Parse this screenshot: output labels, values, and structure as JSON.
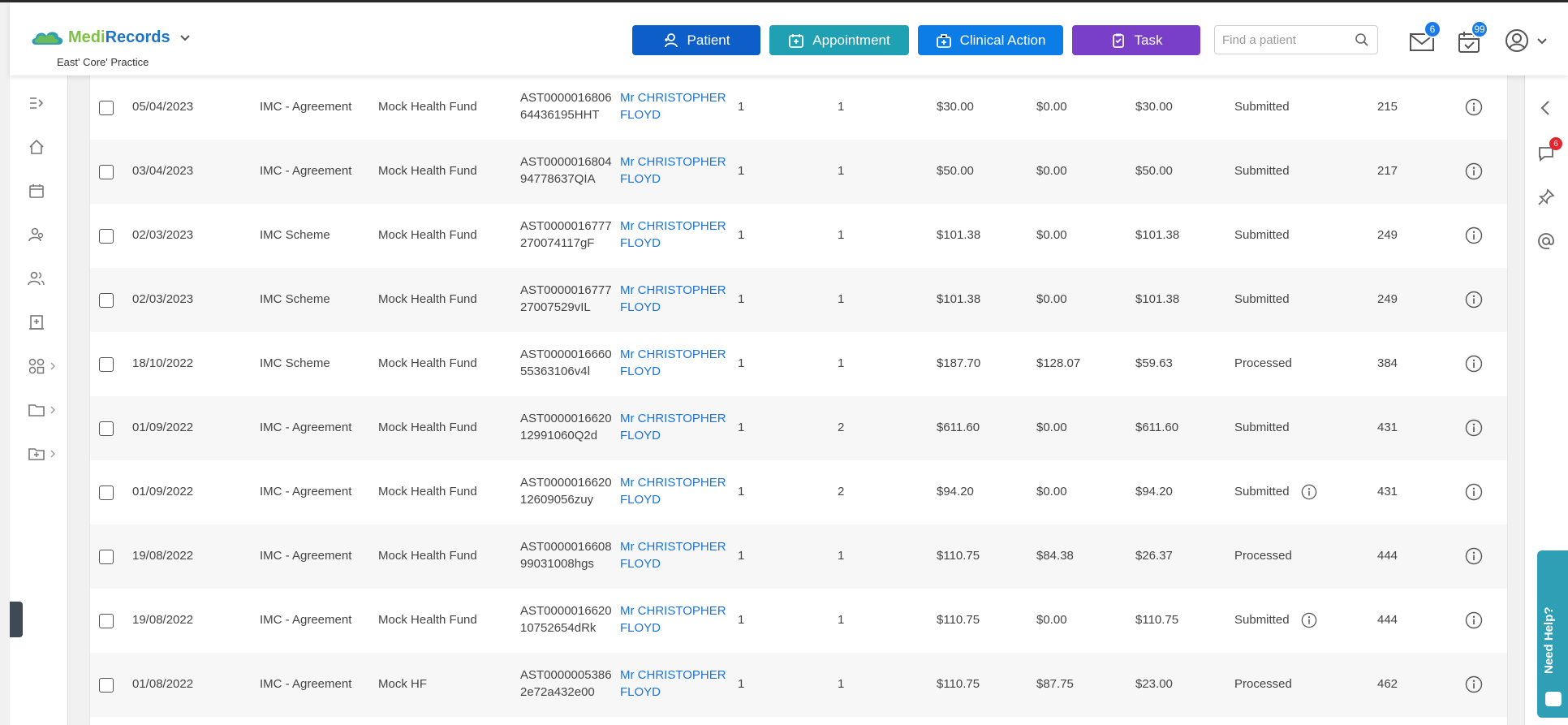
{
  "app": {
    "brand_part1": "Medi",
    "brand_part2": "Records",
    "practice": "East' Core' Practice"
  },
  "header": {
    "buttons": {
      "patient": "Patient",
      "appointment": "Appointment",
      "clinical_action": "Clinical Action",
      "task": "Task"
    },
    "search_placeholder": "Find a patient",
    "mail_badge": "6",
    "tasks_badge": "99"
  },
  "right_sidebar": {
    "chat_badge": "6",
    "help_label": "Need Help?"
  },
  "colors": {
    "patient": "#0d5ec9",
    "appointment": "#1fa0b3",
    "clinical_action": "#0c7ce6",
    "task": "#7a3fc9",
    "link": "#1a73d9",
    "help": "#2f9fb6"
  },
  "left_sidebar_icons": [
    "collapse-icon",
    "home-icon",
    "calendar-icon",
    "patients-icon",
    "contacts-icon",
    "clinic-icon",
    "modules-icon",
    "folder-icon",
    "folder-add-icon"
  ],
  "rows": [
    {
      "date": "05/04/2023",
      "type": "IMC - Agreement",
      "fund": "Mock Health Fund",
      "ref1": "AST0000016806",
      "ref2": "64436195HHT",
      "patient1": "Mr CHRISTOPHER",
      "patient2": "FLOYD",
      "n1": "1",
      "n2": "1",
      "amount": "$30.00",
      "paid": "$0.00",
      "balance": "$30.00",
      "status": "Submitted",
      "status_info": false,
      "days": "215"
    },
    {
      "date": "03/04/2023",
      "type": "IMC - Agreement",
      "fund": "Mock Health Fund",
      "ref1": "AST0000016804",
      "ref2": "94778637QIA",
      "patient1": "Mr CHRISTOPHER",
      "patient2": "FLOYD",
      "n1": "1",
      "n2": "1",
      "amount": "$50.00",
      "paid": "$0.00",
      "balance": "$50.00",
      "status": "Submitted",
      "status_info": false,
      "days": "217"
    },
    {
      "date": "02/03/2023",
      "type": "IMC Scheme",
      "fund": "Mock Health Fund",
      "ref1": "AST0000016777",
      "ref2": "270074117gF",
      "patient1": "Mr CHRISTOPHER",
      "patient2": "FLOYD",
      "n1": "1",
      "n2": "1",
      "amount": "$101.38",
      "paid": "$0.00",
      "balance": "$101.38",
      "status": "Submitted",
      "status_info": false,
      "days": "249"
    },
    {
      "date": "02/03/2023",
      "type": "IMC Scheme",
      "fund": "Mock Health Fund",
      "ref1": "AST0000016777",
      "ref2": "27007529vIL",
      "patient1": "Mr CHRISTOPHER",
      "patient2": "FLOYD",
      "n1": "1",
      "n2": "1",
      "amount": "$101.38",
      "paid": "$0.00",
      "balance": "$101.38",
      "status": "Submitted",
      "status_info": false,
      "days": "249"
    },
    {
      "date": "18/10/2022",
      "type": "IMC Scheme",
      "fund": "Mock Health Fund",
      "ref1": "AST0000016660",
      "ref2": "55363106v4l",
      "patient1": "Mr CHRISTOPHER",
      "patient2": "FLOYD",
      "n1": "1",
      "n2": "1",
      "amount": "$187.70",
      "paid": "$128.07",
      "balance": "$59.63",
      "status": "Processed",
      "status_info": false,
      "days": "384"
    },
    {
      "date": "01/09/2022",
      "type": "IMC - Agreement",
      "fund": "Mock Health Fund",
      "ref1": "AST0000016620",
      "ref2": "12991060Q2d",
      "patient1": "Mr CHRISTOPHER",
      "patient2": "FLOYD",
      "n1": "1",
      "n2": "2",
      "amount": "$611.60",
      "paid": "$0.00",
      "balance": "$611.60",
      "status": "Submitted",
      "status_info": false,
      "days": "431"
    },
    {
      "date": "01/09/2022",
      "type": "IMC - Agreement",
      "fund": "Mock Health Fund",
      "ref1": "AST0000016620",
      "ref2": "12609056zuy",
      "patient1": "Mr CHRISTOPHER",
      "patient2": "FLOYD",
      "n1": "1",
      "n2": "2",
      "amount": "$94.20",
      "paid": "$0.00",
      "balance": "$94.20",
      "status": "Submitted",
      "status_info": true,
      "days": "431"
    },
    {
      "date": "19/08/2022",
      "type": "IMC - Agreement",
      "fund": "Mock Health Fund",
      "ref1": "AST0000016608",
      "ref2": "99031008hgs",
      "patient1": "Mr CHRISTOPHER",
      "patient2": "FLOYD",
      "n1": "1",
      "n2": "1",
      "amount": "$110.75",
      "paid": "$84.38",
      "balance": "$26.37",
      "status": "Processed",
      "status_info": false,
      "days": "444"
    },
    {
      "date": "19/08/2022",
      "type": "IMC - Agreement",
      "fund": "Mock Health Fund",
      "ref1": "AST0000016620",
      "ref2": "10752654dRk",
      "patient1": "Mr CHRISTOPHER",
      "patient2": "FLOYD",
      "n1": "1",
      "n2": "1",
      "amount": "$110.75",
      "paid": "$0.00",
      "balance": "$110.75",
      "status": "Submitted",
      "status_info": true,
      "days": "444"
    },
    {
      "date": "01/08/2022",
      "type": "IMC - Agreement",
      "fund": "Mock HF",
      "ref1": "AST0000005386",
      "ref2": "2e72a432e00",
      "patient1": "Mr CHRISTOPHER",
      "patient2": "FLOYD",
      "n1": "1",
      "n2": "1",
      "amount": "$110.75",
      "paid": "$87.75",
      "balance": "$23.00",
      "status": "Processed",
      "status_info": false,
      "days": "462"
    }
  ]
}
